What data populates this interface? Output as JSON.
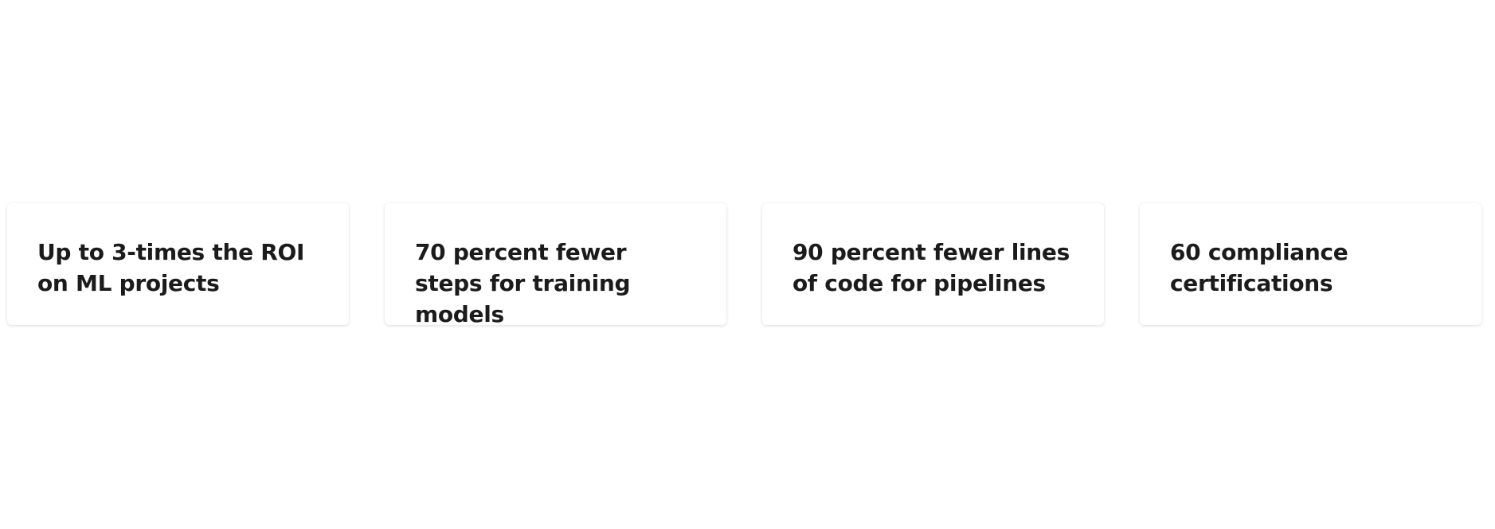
{
  "stats": [
    {
      "text": "Up to 3-times the ROI on ML projects"
    },
    {
      "text": "70 percent fewer steps for training models"
    },
    {
      "text": "90 percent fewer lines of code for pipelines"
    },
    {
      "text": "60 compliance certifications"
    }
  ]
}
